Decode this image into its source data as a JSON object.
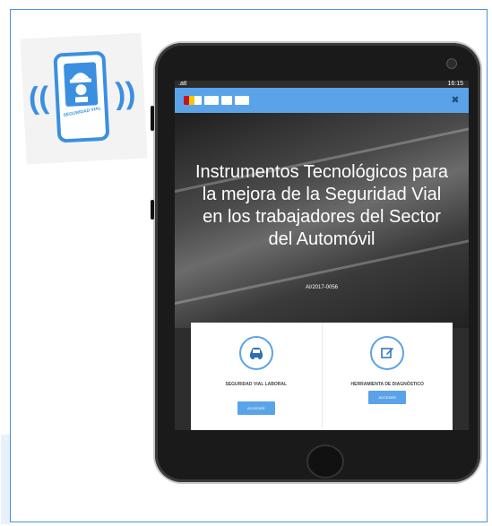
{
  "app_icon": {
    "label": "SEGURIDAD VIAL",
    "accent": "#3b8fe0"
  },
  "tablet": {
    "status": {
      "signal": ".atl",
      "time": "16:15"
    },
    "topbar": {
      "menu_icon": "close-icon",
      "color": "#5ba3e8"
    },
    "hero": {
      "title": "Instrumentos Tecnológicos para la mejora de la Seguridad Vial en los trabajadores del Sector del Automóvil",
      "code": "AI/2017-0056"
    },
    "cards": [
      {
        "icon": "car-icon",
        "label": "SEGURIDAD VIAL LABORAL",
        "button": "ACCEDER"
      },
      {
        "icon": "edit-icon",
        "label": "HERRAMIENTA DE DIAGNÓSTICO",
        "button": "ACCEDER"
      }
    ]
  }
}
